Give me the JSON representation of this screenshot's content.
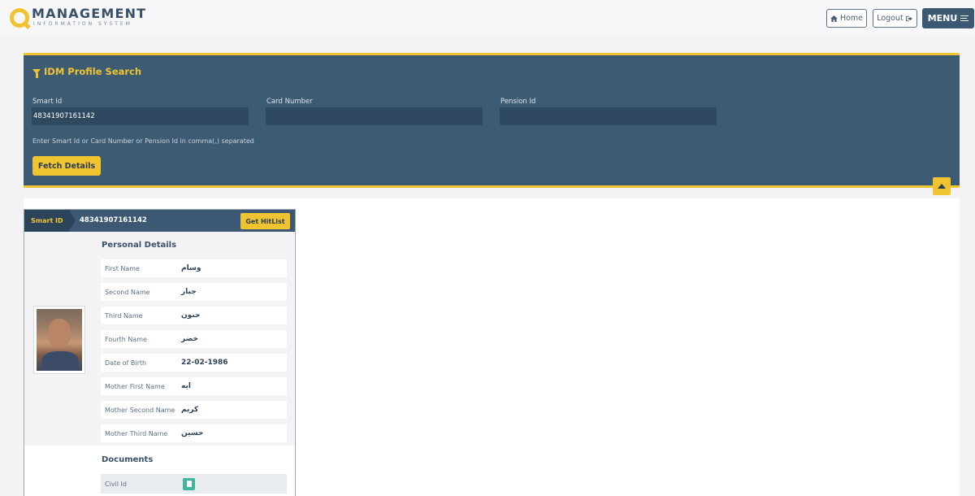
{
  "header": {
    "logo_main": "MANAGEMENT",
    "logo_sub": "INFORMATION SYSTEM",
    "home_label": "Home",
    "logout_label": "Logout",
    "menu_label": "MENU"
  },
  "search": {
    "title": "IDM Profile Search",
    "fields": [
      {
        "label": "Smart Id",
        "value": "48341907161142",
        "placeholder": ""
      },
      {
        "label": "Card Number",
        "value": "",
        "placeholder": ""
      },
      {
        "label": "Pension Id",
        "value": "",
        "placeholder": ""
      }
    ],
    "hint": "Enter Smart Id or Card Number or Pension Id in comma(,) separated",
    "fetch_label": "Fetch Details"
  },
  "profile": {
    "smart_id_tag": "Smart ID",
    "smart_id_value": "48341907161142",
    "hitlist_label": "Get HitList",
    "personal_title": "Personal Details",
    "personal": [
      {
        "label": "First Name",
        "value": "وسام"
      },
      {
        "label": "Second Name",
        "value": "جبار"
      },
      {
        "label": "Third Name",
        "value": "حنون"
      },
      {
        "label": "Fourth Name",
        "value": "خضر"
      },
      {
        "label": "Date of Birth",
        "value": "22-02-1986"
      },
      {
        "label": "Mother First Name",
        "value": "ايه"
      },
      {
        "label": "Mother Second Name",
        "value": "كريم"
      },
      {
        "label": "Mother Third Name",
        "value": "حسين"
      }
    ],
    "documents_title": "Documents",
    "documents": [
      {
        "label": "Civil Id",
        "icon": "document-icon"
      }
    ]
  },
  "colors": {
    "accent": "#f0c330",
    "panel": "#3d5b73",
    "dark": "#2c445a"
  }
}
